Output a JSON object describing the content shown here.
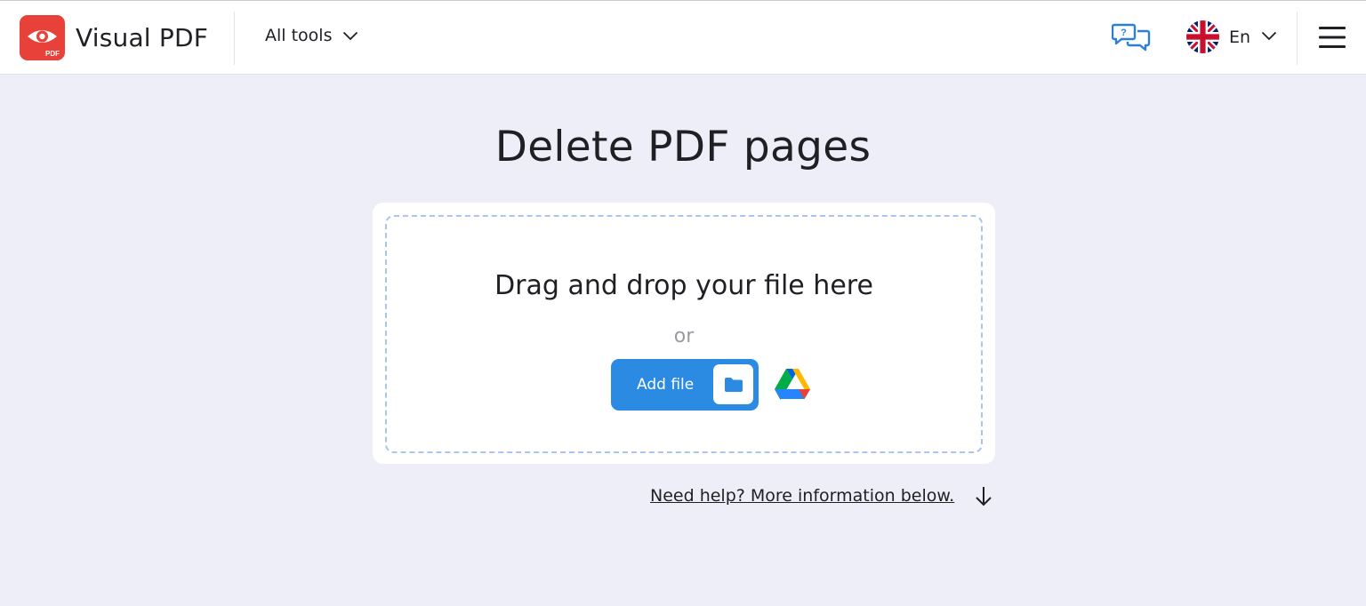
{
  "header": {
    "brand": "Visual PDF",
    "logo_badge_text": "PDF",
    "all_tools_label": "All tools",
    "language_label": "En"
  },
  "main": {
    "title": "Delete PDF pages",
    "dropzone": {
      "heading": "Drag and drop your file here",
      "or_text": "or",
      "add_file_label": "Add file"
    },
    "help_link": "Need help? More information below."
  },
  "colors": {
    "accent": "#2b8ae2",
    "brand_red": "#e8413a",
    "background": "#eeeef8"
  }
}
